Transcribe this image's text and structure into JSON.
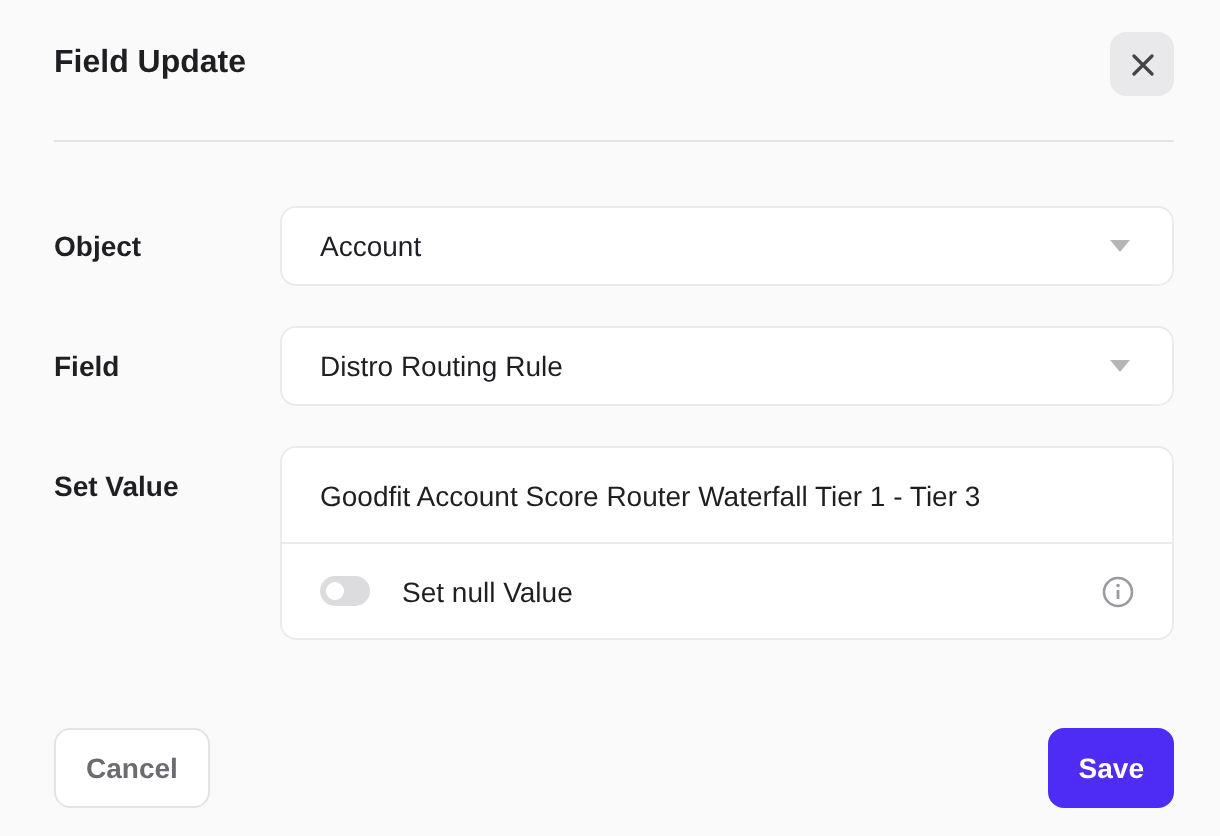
{
  "dialog": {
    "title": "Field Update"
  },
  "fields": [
    {
      "label": "Object",
      "kind": "select",
      "value": "Account"
    },
    {
      "label": "Field",
      "kind": "select",
      "value": "Distro Routing Rule"
    },
    {
      "label": "Set Value",
      "kind": "value",
      "value": "Goodfit Account Score Router Waterfall Tier 1 - Tier 3",
      "null_toggle": {
        "label": "Set null Value",
        "on": false
      }
    }
  ],
  "buttons": [
    {
      "label": "Cancel",
      "kind": "secondary"
    },
    {
      "label": "Save",
      "kind": "primary"
    }
  ]
}
